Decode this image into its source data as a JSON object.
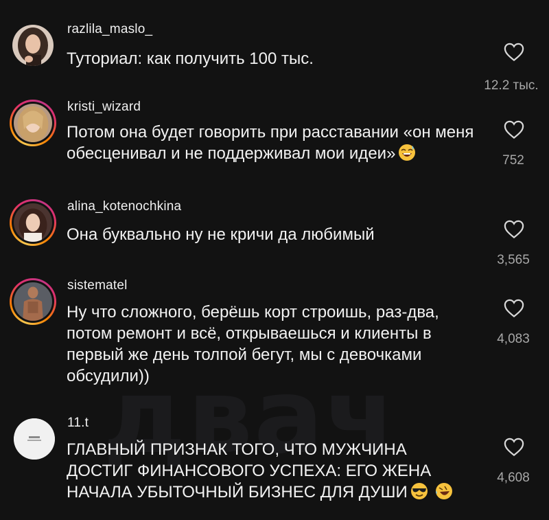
{
  "watermark": "двач",
  "comments": [
    {
      "username": "razlila_maslo_",
      "text": "Туториал: как получить 100 тыс.",
      "likes": "12.2 тыс."
    },
    {
      "username": "kristi_wizard",
      "text": "Потом она будет говорить при расставании «он меня обесценивал и не поддерживал мои идеи»",
      "emoji": "laughing-sweat-emoji",
      "likes": "752"
    },
    {
      "username": "alina_kotenochkina",
      "text": "Она буквально ну не кричи да любимый",
      "likes": "3,565"
    },
    {
      "username": "sistematel",
      "text": "Ну что сложного, берёшь корт строишь, раз-два, потом ремонт и всё, открываешься и клиенты в первый же день толпой бегут, мы с девочками обсудили))",
      "likes": "4,083"
    },
    {
      "username": "11.t",
      "text": "ГЛАВНЫЙ ПРИЗНАК ТОГО, ЧТО МУЖЧИНА ДОСТИГ ФИНАНСОВОГО УСПЕХА: ЕГО ЖЕНА НАЧАЛА УБЫТОЧНЫЙ БИЗНЕС ДЛЯ ДУШИ",
      "emoji": "sunglasses-emoji",
      "emoji2": "rolling-laughing-emoji",
      "likes": "4,608"
    }
  ],
  "icons": {
    "like": "heart-outline-icon"
  },
  "colors": {
    "background": "#121212",
    "text": "#f2f2f2",
    "muted": "#a8a8a8",
    "story_ring": "#e1306c"
  }
}
